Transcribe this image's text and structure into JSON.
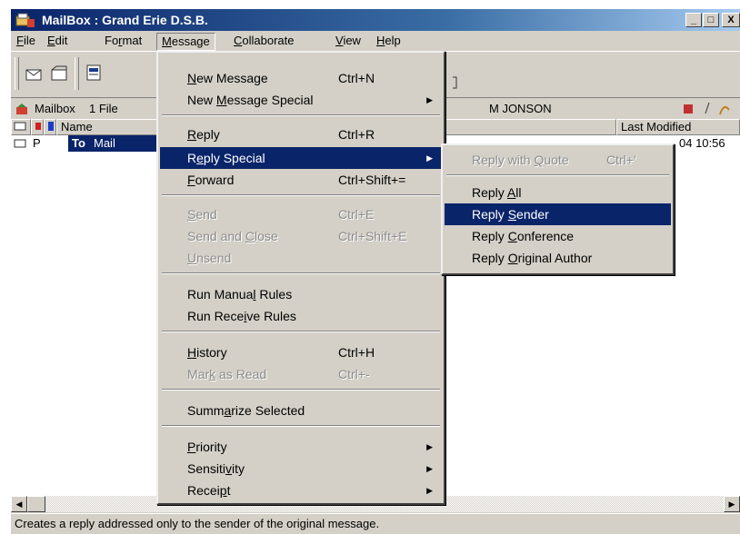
{
  "window": {
    "title": "MailBox : Grand Erie D.S.B.",
    "min_label": "_",
    "max_label": "□",
    "close_label": "X"
  },
  "menubar": {
    "items": [
      {
        "pre": "",
        "u": "F",
        "post": "ile"
      },
      {
        "pre": "",
        "u": "E",
        "post": "dit"
      },
      {
        "pre": "Fo",
        "u": "r",
        "post": "mat"
      },
      {
        "pre": "",
        "u": "M",
        "post": "essage"
      },
      {
        "pre": "",
        "u": "C",
        "post": "ollaborate"
      },
      {
        "pre": "",
        "u": "V",
        "post": "iew"
      },
      {
        "pre": "",
        "u": "H",
        "post": "elp"
      }
    ]
  },
  "infobar": {
    "mailbox_label": "Mailbox",
    "file_count": "1 File",
    "owner_fragment": "M JONSON"
  },
  "list": {
    "headers": {
      "name": "Name",
      "last_modified": "Last Modified"
    },
    "row": {
      "type_flag": "P",
      "to": "To",
      "name": "Mail",
      "modified_fragment": "04  10:56"
    }
  },
  "message_menu": {
    "new_message": {
      "pre": "",
      "u": "N",
      "post": "ew Message",
      "shortcut": "Ctrl+N"
    },
    "new_message_special": {
      "pre": "New ",
      "u": "M",
      "post": "essage Special"
    },
    "reply": {
      "pre": "",
      "u": "R",
      "post": "eply",
      "shortcut": "Ctrl+R"
    },
    "reply_special": {
      "pre": "R",
      "u": "e",
      "post": "ply Special"
    },
    "forward": {
      "pre": "",
      "u": "F",
      "post": "orward",
      "shortcut": "Ctrl+Shift+="
    },
    "send": {
      "pre": "",
      "u": "S",
      "post": "end",
      "shortcut": "Ctrl+E"
    },
    "send_and_close": {
      "pre": "Send and ",
      "u": "C",
      "post": "lose",
      "shortcut": "Ctrl+Shift+E"
    },
    "unsend": {
      "pre": "",
      "u": "U",
      "post": "nsend"
    },
    "run_manual_rules": {
      "pre": "Run Manua",
      "u": "l",
      "post": " Rules"
    },
    "run_receive_rules": {
      "pre": "Run Rece",
      "u": "i",
      "post": "ve Rules"
    },
    "history": {
      "pre": "",
      "u": "H",
      "post": "istory",
      "shortcut": "Ctrl+H"
    },
    "mark_as_read": {
      "pre": "Mar",
      "u": "k",
      "post": " as Read",
      "shortcut": "Ctrl+-"
    },
    "summarize_selected": {
      "pre": "Summ",
      "u": "a",
      "post": "rize Selected"
    },
    "priority": {
      "pre": "",
      "u": "P",
      "post": "riority"
    },
    "sensitivity": {
      "pre": "Sensiti",
      "u": "v",
      "post": "ity"
    },
    "receipt": {
      "pre": "Recei",
      "u": "p",
      "post": "t"
    }
  },
  "reply_special_menu": {
    "reply_with_quote": {
      "pre": "Reply with ",
      "u": "Q",
      "post": "uote",
      "shortcut": "Ctrl+'"
    },
    "reply_all": {
      "pre": "Reply ",
      "u": "A",
      "post": "ll"
    },
    "reply_sender": {
      "pre": "Reply ",
      "u": "S",
      "post": "ender"
    },
    "reply_conference": {
      "pre": "Reply ",
      "u": "C",
      "post": "onference"
    },
    "reply_original_author": {
      "pre": "Reply ",
      "u": "O",
      "post": "riginal Author"
    }
  },
  "statusbar": {
    "text": "Creates a reply addressed only to the sender of the original message."
  },
  "colors": {
    "title_bar": "#0a246a",
    "selection": "#0a246a",
    "chrome": "#d4d0c8"
  }
}
